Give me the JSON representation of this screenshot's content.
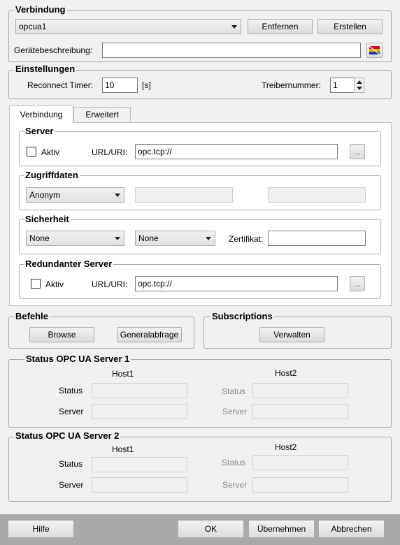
{
  "verbindung": {
    "legend": "Verbindung",
    "connection_value": "opcua1",
    "remove_label": "Entfernen",
    "create_label": "Erstellen",
    "device_desc_label": "Gerätebeschreibung:",
    "device_desc_value": ""
  },
  "einstellungen": {
    "legend": "Einstellungen",
    "reconnect_label": "Reconnect Timer:",
    "reconnect_value": "10",
    "reconnect_unit": "[s]",
    "driver_label": "Treibernummer:",
    "driver_value": "1"
  },
  "tabs": [
    {
      "label": "Verbindung"
    },
    {
      "label": "Erweitert"
    }
  ],
  "server": {
    "legend": "Server",
    "active_label": "Aktiv",
    "url_label": "URL/URI:",
    "url_value": "opc.tcp://",
    "browse_label": "..."
  },
  "zugriff": {
    "legend": "Zugriffdaten",
    "auth_value": "Anonym"
  },
  "sicherheit": {
    "legend": "Sicherheit",
    "policy_value": "None",
    "mode_value": "None",
    "cert_label": "Zertifikat:",
    "cert_value": ""
  },
  "redundant": {
    "legend": "Redundanter Server",
    "active_label": "Aktiv",
    "url_label": "URL/URI:",
    "url_value": "opc.tcp://",
    "browse_label": "..."
  },
  "befehle": {
    "legend": "Befehle",
    "browse_label": "Browse",
    "general_label": "Generalabfrage"
  },
  "subscriptions": {
    "legend": "Subscriptions",
    "manage_label": "Verwalten"
  },
  "status1": {
    "legend": "Status OPC UA Server 1",
    "host1": "Host1",
    "host2": "Host2",
    "status_label": "Status",
    "server_label": "Server"
  },
  "status2": {
    "legend": "Status OPC UA Server 2",
    "host1": "Host1",
    "host2": "Host2",
    "status_label": "Status",
    "server_label": "Server"
  },
  "footer": {
    "help_label": "Hilfe",
    "ok_label": "OK",
    "apply_label": "Übernehmen",
    "cancel_label": "Abbrechen"
  }
}
